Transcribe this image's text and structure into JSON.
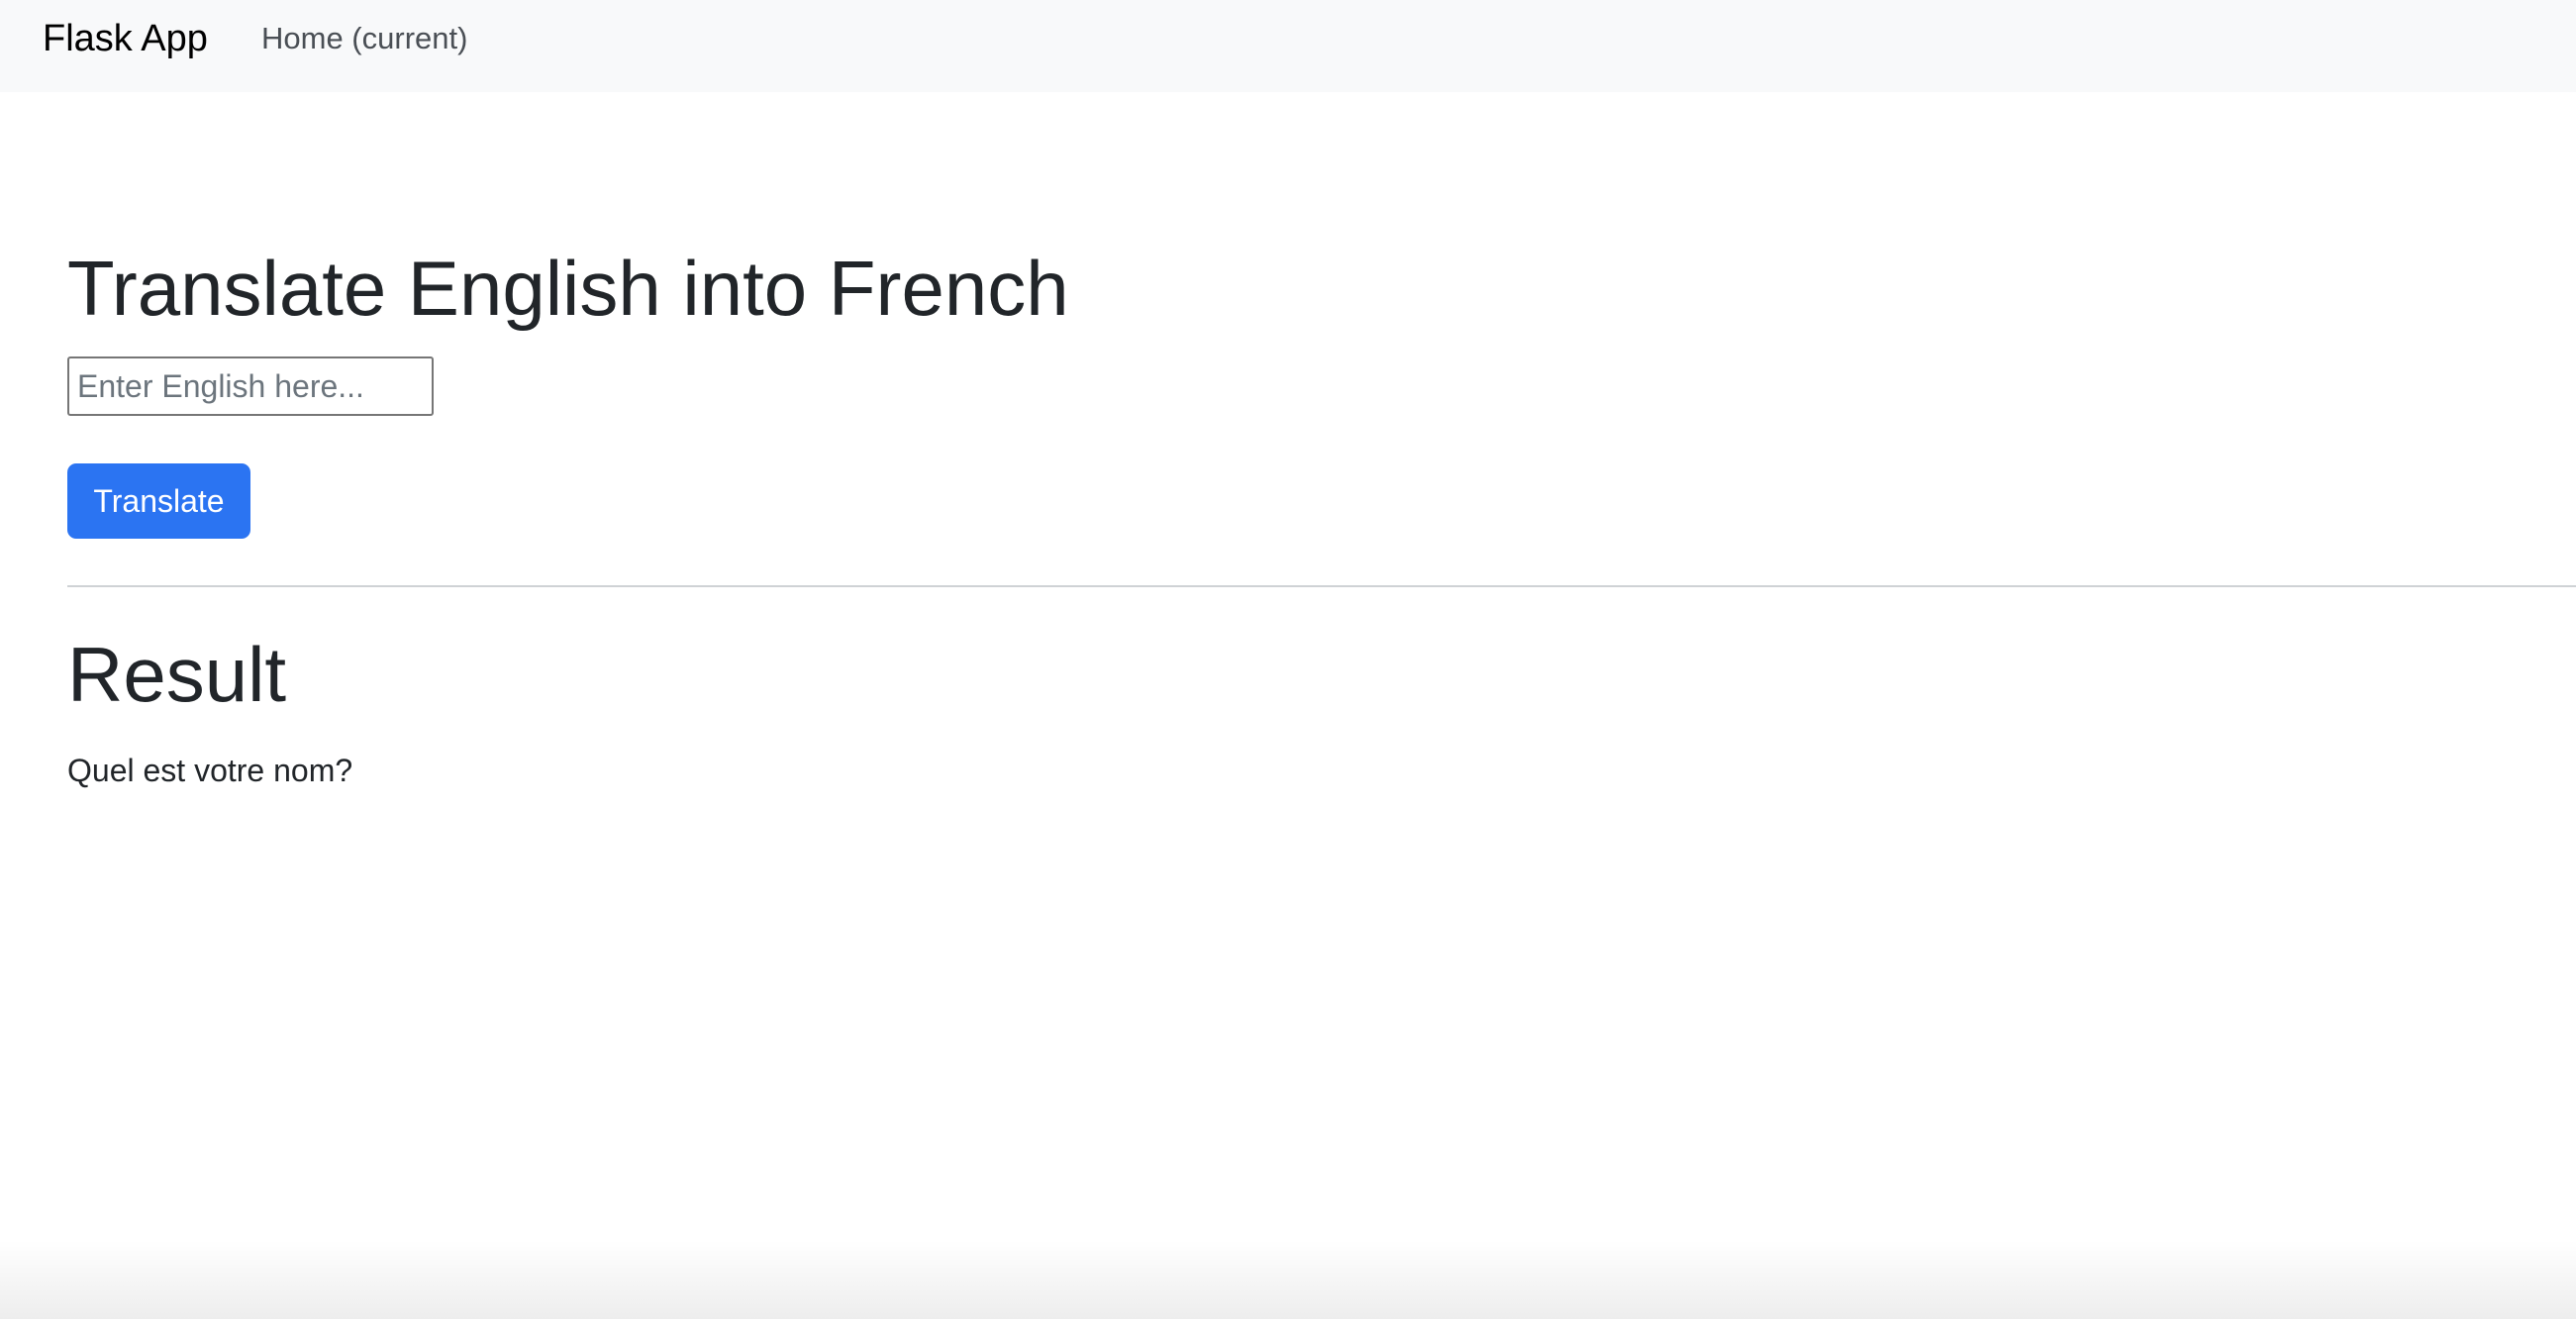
{
  "navbar": {
    "brand": "Flask App",
    "links": [
      {
        "label": "Home (current)"
      }
    ]
  },
  "main": {
    "title": "Translate English into French",
    "input": {
      "value": "",
      "placeholder": "Enter English here..."
    },
    "button_label": "Translate"
  },
  "result": {
    "heading": "Result",
    "text": "Quel est votre nom?"
  },
  "colors": {
    "navbar_bg": "#f8f9fa",
    "primary_button": "#2b74f2",
    "text": "#212529"
  }
}
